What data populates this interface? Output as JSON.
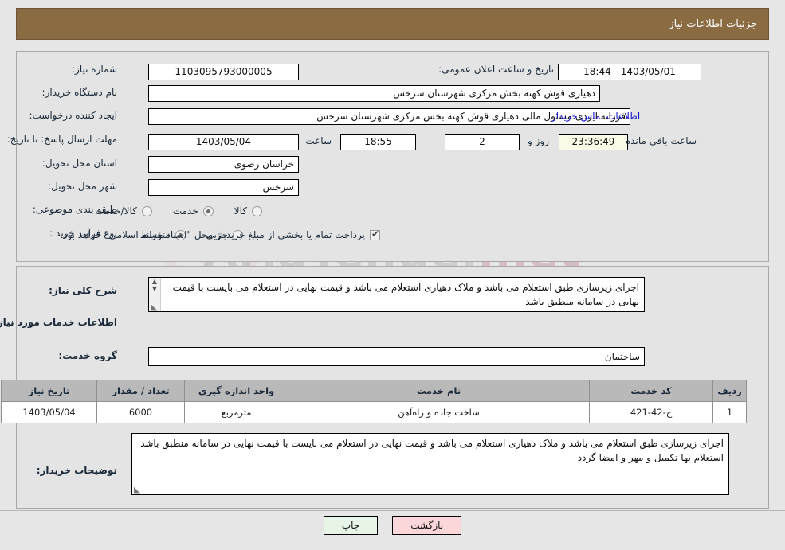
{
  "header": {
    "title": "جزئیات اطلاعات نیاز"
  },
  "form": {
    "need_number_label": "شماره نیاز:",
    "need_number_value": "1103095793000005",
    "announce_label": "تاریخ و ساعت اعلان عمومی:",
    "announce_value": "1403/05/01 - 18:44",
    "buyer_org_label": "نام دستگاه خریدار:",
    "buyer_org_value": "دهیاری قوش کهنه بخش مرکزی شهرستان سرخس",
    "creator_label": "ایجاد کننده درخواست:",
    "creator_value": "فرزانه ایزدی مسئول مالی دهیاری قوش کهنه بخش مرکزی شهرستان سرخس",
    "contact_link": "اطلاعات تماس خریدار",
    "deadline_label": "مهلت ارسال پاسخ: تا تاریخ:",
    "deadline_date": "1403/05/04",
    "deadline_time_label": "ساعت",
    "deadline_time": "18:55",
    "remaining_days": "2",
    "remaining_days_label": "روز و",
    "remaining_clock": "23:36:49",
    "remaining_suffix": "ساعت باقی مانده",
    "province_label": "استان محل تحویل:",
    "province_value": "خراسان رضوی",
    "city_label": "شهر محل تحویل:",
    "city_value": "سرخس",
    "category_label": "طبقه بندی موضوعی:",
    "category_options": [
      {
        "label": "کالا",
        "selected": false
      },
      {
        "label": "خدمت",
        "selected": true
      },
      {
        "label": "کالا/خدمت",
        "selected": false
      }
    ],
    "process_label": "نوع فرآیند خرید :",
    "process_options": [
      {
        "label": "جزیی",
        "selected": false
      },
      {
        "label": "متوسط",
        "selected": true
      }
    ],
    "treasury_checkbox_checked": true,
    "treasury_note": "پرداخت تمام یا بخشی از مبلغ خرید،از محل \"اسناد خزانه اسلامی\" خواهد بود."
  },
  "summary": {
    "label": "شرح کلی نیاز:",
    "text": "اجرای زیرسازی طبق استعلام می باشد و ملاک دهیاری استعلام می باشد و قیمت نهایی در استعلام می بایست با قیمت نهایی در سامانه منطبق باشد"
  },
  "services": {
    "section_title": "اطلاعات خدمات مورد نیاز",
    "group_label": "گروه خدمت:",
    "group_value": "ساختمان",
    "columns": [
      "ردیف",
      "کد خدمت",
      "نام خدمت",
      "واحد اندازه گیری",
      "تعداد / مقدار",
      "تاریخ نیاز"
    ],
    "rows": [
      {
        "radif": "1",
        "code": "ج-42-421",
        "name": "ساخت جاده و راه‌آهن",
        "unit": "مترمربع",
        "qty": "6000",
        "date": "1403/05/04"
      }
    ]
  },
  "buyer_notes": {
    "label": "توضیحات خریدار:",
    "text": "اجرای زیرسازی طبق استعلام می باشد و ملاک دهیاری استعلام می باشد و قیمت نهایی در استعلام می بایست با قیمت نهایی در سامانه منطبق باشد\nاستعلام بها تکمیل و مهر و امضا گردد"
  },
  "footer": {
    "print_label": "چاپ",
    "back_label": "بازگشت"
  },
  "watermark": {
    "text_left": "AriaTender",
    "text_right": ".net"
  },
  "colors": {
    "header_bg": "#8b6c42",
    "panel_bg": "#e4e4e4",
    "link": "#1515d0",
    "table_header": "#b9b9b9",
    "print_btn": "#e6f5e6",
    "back_btn": "#fbd7da",
    "timer_bg": "#fbfbe8"
  }
}
